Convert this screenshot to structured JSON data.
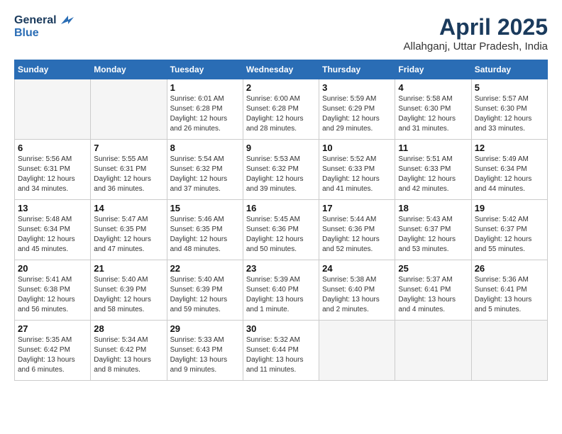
{
  "header": {
    "logo_line1": "General",
    "logo_line2": "Blue",
    "month_title": "April 2025",
    "location": "Allahganj, Uttar Pradesh, India"
  },
  "weekdays": [
    "Sunday",
    "Monday",
    "Tuesday",
    "Wednesday",
    "Thursday",
    "Friday",
    "Saturday"
  ],
  "weeks": [
    [
      {
        "day": "",
        "sunrise": "",
        "sunset": "",
        "daylight": "",
        "empty": true
      },
      {
        "day": "",
        "sunrise": "",
        "sunset": "",
        "daylight": "",
        "empty": true
      },
      {
        "day": "1",
        "sunrise": "Sunrise: 6:01 AM",
        "sunset": "Sunset: 6:28 PM",
        "daylight": "Daylight: 12 hours and 26 minutes."
      },
      {
        "day": "2",
        "sunrise": "Sunrise: 6:00 AM",
        "sunset": "Sunset: 6:28 PM",
        "daylight": "Daylight: 12 hours and 28 minutes."
      },
      {
        "day": "3",
        "sunrise": "Sunrise: 5:59 AM",
        "sunset": "Sunset: 6:29 PM",
        "daylight": "Daylight: 12 hours and 29 minutes."
      },
      {
        "day": "4",
        "sunrise": "Sunrise: 5:58 AM",
        "sunset": "Sunset: 6:30 PM",
        "daylight": "Daylight: 12 hours and 31 minutes."
      },
      {
        "day": "5",
        "sunrise": "Sunrise: 5:57 AM",
        "sunset": "Sunset: 6:30 PM",
        "daylight": "Daylight: 12 hours and 33 minutes."
      }
    ],
    [
      {
        "day": "6",
        "sunrise": "Sunrise: 5:56 AM",
        "sunset": "Sunset: 6:31 PM",
        "daylight": "Daylight: 12 hours and 34 minutes."
      },
      {
        "day": "7",
        "sunrise": "Sunrise: 5:55 AM",
        "sunset": "Sunset: 6:31 PM",
        "daylight": "Daylight: 12 hours and 36 minutes."
      },
      {
        "day": "8",
        "sunrise": "Sunrise: 5:54 AM",
        "sunset": "Sunset: 6:32 PM",
        "daylight": "Daylight: 12 hours and 37 minutes."
      },
      {
        "day": "9",
        "sunrise": "Sunrise: 5:53 AM",
        "sunset": "Sunset: 6:32 PM",
        "daylight": "Daylight: 12 hours and 39 minutes."
      },
      {
        "day": "10",
        "sunrise": "Sunrise: 5:52 AM",
        "sunset": "Sunset: 6:33 PM",
        "daylight": "Daylight: 12 hours and 41 minutes."
      },
      {
        "day": "11",
        "sunrise": "Sunrise: 5:51 AM",
        "sunset": "Sunset: 6:33 PM",
        "daylight": "Daylight: 12 hours and 42 minutes."
      },
      {
        "day": "12",
        "sunrise": "Sunrise: 5:49 AM",
        "sunset": "Sunset: 6:34 PM",
        "daylight": "Daylight: 12 hours and 44 minutes."
      }
    ],
    [
      {
        "day": "13",
        "sunrise": "Sunrise: 5:48 AM",
        "sunset": "Sunset: 6:34 PM",
        "daylight": "Daylight: 12 hours and 45 minutes."
      },
      {
        "day": "14",
        "sunrise": "Sunrise: 5:47 AM",
        "sunset": "Sunset: 6:35 PM",
        "daylight": "Daylight: 12 hours and 47 minutes."
      },
      {
        "day": "15",
        "sunrise": "Sunrise: 5:46 AM",
        "sunset": "Sunset: 6:35 PM",
        "daylight": "Daylight: 12 hours and 48 minutes."
      },
      {
        "day": "16",
        "sunrise": "Sunrise: 5:45 AM",
        "sunset": "Sunset: 6:36 PM",
        "daylight": "Daylight: 12 hours and 50 minutes."
      },
      {
        "day": "17",
        "sunrise": "Sunrise: 5:44 AM",
        "sunset": "Sunset: 6:36 PM",
        "daylight": "Daylight: 12 hours and 52 minutes."
      },
      {
        "day": "18",
        "sunrise": "Sunrise: 5:43 AM",
        "sunset": "Sunset: 6:37 PM",
        "daylight": "Daylight: 12 hours and 53 minutes."
      },
      {
        "day": "19",
        "sunrise": "Sunrise: 5:42 AM",
        "sunset": "Sunset: 6:37 PM",
        "daylight": "Daylight: 12 hours and 55 minutes."
      }
    ],
    [
      {
        "day": "20",
        "sunrise": "Sunrise: 5:41 AM",
        "sunset": "Sunset: 6:38 PM",
        "daylight": "Daylight: 12 hours and 56 minutes."
      },
      {
        "day": "21",
        "sunrise": "Sunrise: 5:40 AM",
        "sunset": "Sunset: 6:39 PM",
        "daylight": "Daylight: 12 hours and 58 minutes."
      },
      {
        "day": "22",
        "sunrise": "Sunrise: 5:40 AM",
        "sunset": "Sunset: 6:39 PM",
        "daylight": "Daylight: 12 hours and 59 minutes."
      },
      {
        "day": "23",
        "sunrise": "Sunrise: 5:39 AM",
        "sunset": "Sunset: 6:40 PM",
        "daylight": "Daylight: 13 hours and 1 minute."
      },
      {
        "day": "24",
        "sunrise": "Sunrise: 5:38 AM",
        "sunset": "Sunset: 6:40 PM",
        "daylight": "Daylight: 13 hours and 2 minutes."
      },
      {
        "day": "25",
        "sunrise": "Sunrise: 5:37 AM",
        "sunset": "Sunset: 6:41 PM",
        "daylight": "Daylight: 13 hours and 4 minutes."
      },
      {
        "day": "26",
        "sunrise": "Sunrise: 5:36 AM",
        "sunset": "Sunset: 6:41 PM",
        "daylight": "Daylight: 13 hours and 5 minutes."
      }
    ],
    [
      {
        "day": "27",
        "sunrise": "Sunrise: 5:35 AM",
        "sunset": "Sunset: 6:42 PM",
        "daylight": "Daylight: 13 hours and 6 minutes."
      },
      {
        "day": "28",
        "sunrise": "Sunrise: 5:34 AM",
        "sunset": "Sunset: 6:42 PM",
        "daylight": "Daylight: 13 hours and 8 minutes."
      },
      {
        "day": "29",
        "sunrise": "Sunrise: 5:33 AM",
        "sunset": "Sunset: 6:43 PM",
        "daylight": "Daylight: 13 hours and 9 minutes."
      },
      {
        "day": "30",
        "sunrise": "Sunrise: 5:32 AM",
        "sunset": "Sunset: 6:44 PM",
        "daylight": "Daylight: 13 hours and 11 minutes."
      },
      {
        "day": "",
        "sunrise": "",
        "sunset": "",
        "daylight": "",
        "empty": true
      },
      {
        "day": "",
        "sunrise": "",
        "sunset": "",
        "daylight": "",
        "empty": true
      },
      {
        "day": "",
        "sunrise": "",
        "sunset": "",
        "daylight": "",
        "empty": true
      }
    ]
  ]
}
